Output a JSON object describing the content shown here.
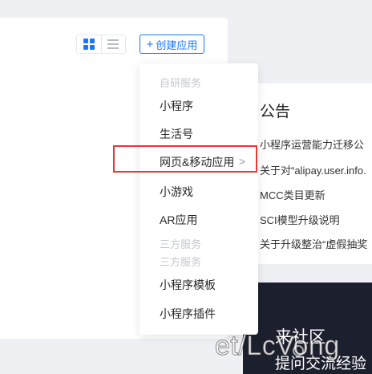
{
  "toolbar": {
    "create_label": "创建应用",
    "create_plus": "+"
  },
  "menu": {
    "group_self": "自研服务",
    "items_self": [
      "小程序",
      "生活号",
      "网页&移动应用",
      "小游戏",
      "AR应用"
    ],
    "group_third_a": "三方服务",
    "group_third_b": "三方服务",
    "items_third": [
      "小程序模板",
      "小程序插件"
    ],
    "submenu_arrow": ">"
  },
  "notice": {
    "title": "公告",
    "items": [
      "小程序运营能力迁移公",
      "关于对“alipay.user.info.",
      "MCC类目更新",
      "SCI模型升级说明",
      "关于升级整治“虚假抽奖"
    ]
  },
  "community": {
    "title": "来社区",
    "subtitle": "提问交流经验"
  },
  "watermark": {
    "text": "et/LcVong"
  },
  "colors": {
    "accent": "#1677ff",
    "highlight": "#e53935",
    "banner": "#1c1f2e"
  }
}
